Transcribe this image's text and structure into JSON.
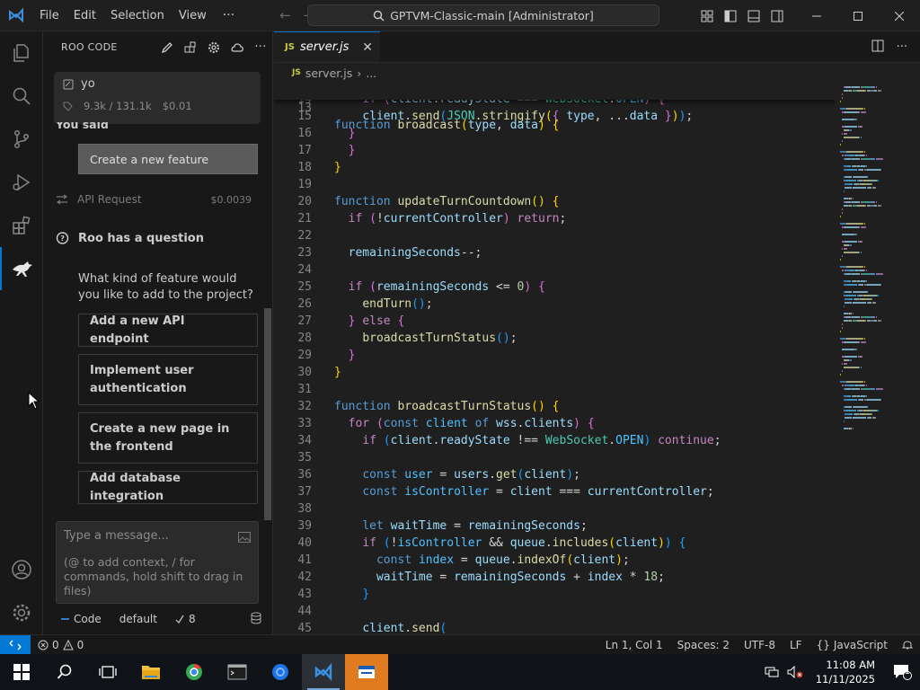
{
  "titlebar": {
    "menu": [
      "File",
      "Edit",
      "Selection",
      "View"
    ],
    "more": "···",
    "command_center": "GPTVM-Classic-main [Administrator]"
  },
  "sidebar": {
    "title": "ROO CODE",
    "task": {
      "title": "yo",
      "tokens": "9.3k / 131.1k",
      "cost": "$0.01"
    },
    "you_said": "You said",
    "user_message": "Create a new feature",
    "api_request": {
      "label": "API Request",
      "cost": "$0.0039"
    },
    "question_title": "Roo has a question",
    "question": "What kind of feature would you like to add to the project?",
    "suggestions": [
      "Add a new API endpoint",
      "Implement user authentication",
      "Create a new page in the frontend",
      "Add database integration"
    ],
    "input": {
      "placeholder": "Type a message...",
      "hint": "(@ to add context, / for commands, hold shift to drag in files)"
    },
    "footer": {
      "mode": "Code",
      "profile": "default",
      "count": "8"
    }
  },
  "editor": {
    "tab": {
      "label": "server.js",
      "icon": "JS"
    },
    "breadcrumb": [
      "server.js",
      "..."
    ],
    "sticky": {
      "num": "13",
      "segs": [
        [
          "k",
          "function "
        ],
        [
          "f",
          "broadcast"
        ],
        [
          "p1",
          "("
        ],
        [
          "v",
          "type"
        ],
        [
          "",
          ","
        ],
        [
          "v",
          " data"
        ],
        [
          "p1",
          ")"
        ],
        [
          "",
          " "
        ],
        [
          "p1",
          "{"
        ]
      ]
    },
    "lines": [
      {
        "num": "14",
        "segs": [
          [
            "",
            "    "
          ],
          [
            "c",
            "if "
          ],
          [
            "p2",
            "("
          ],
          [
            "v",
            "client"
          ],
          [
            "",
            "."
          ],
          [
            "v",
            "readyState"
          ],
          [
            "",
            " === "
          ],
          [
            "t",
            "WebSocket"
          ],
          [
            "",
            "."
          ],
          [
            "con",
            "OPEN"
          ],
          [
            "p2",
            ")"
          ],
          [
            "",
            " "
          ],
          [
            "p2",
            "{"
          ]
        ]
      },
      {
        "num": "15",
        "segs": [
          [
            "",
            "    "
          ],
          [
            "v",
            "client"
          ],
          [
            "",
            "."
          ],
          [
            "f",
            "send"
          ],
          [
            "p3",
            "("
          ],
          [
            "t",
            "JSON"
          ],
          [
            "",
            "."
          ],
          [
            "f",
            "stringify"
          ],
          [
            "p1",
            "("
          ],
          [
            "p2",
            "{"
          ],
          [
            "",
            " "
          ],
          [
            "v",
            "type"
          ],
          [
            "",
            ", ..."
          ],
          [
            "v",
            "data"
          ],
          [
            "",
            " "
          ],
          [
            "p2",
            "}"
          ],
          [
            "p1",
            ")"
          ],
          [
            "p3",
            ")"
          ],
          [
            "",
            ";"
          ]
        ]
      },
      {
        "num": "16",
        "segs": [
          [
            "",
            "  "
          ],
          [
            "p2",
            "}"
          ]
        ]
      },
      {
        "num": "17",
        "segs": [
          [
            "",
            "  "
          ],
          [
            "p2",
            "}"
          ]
        ]
      },
      {
        "num": "18",
        "segs": [
          [
            "p1",
            "}"
          ]
        ]
      },
      {
        "num": "19",
        "segs": [
          [
            "",
            ""
          ]
        ]
      },
      {
        "num": "20",
        "segs": [
          [
            "k",
            "function "
          ],
          [
            "f",
            "updateTurnCountdown"
          ],
          [
            "p1",
            "()"
          ],
          [
            "",
            " "
          ],
          [
            "p1",
            "{"
          ]
        ]
      },
      {
        "num": "21",
        "segs": [
          [
            "",
            "  "
          ],
          [
            "c",
            "if "
          ],
          [
            "p2",
            "("
          ],
          [
            "",
            "!"
          ],
          [
            "v",
            "currentController"
          ],
          [
            "p2",
            ")"
          ],
          [
            "",
            " "
          ],
          [
            "c",
            "return"
          ],
          [
            "",
            ";"
          ]
        ]
      },
      {
        "num": "22",
        "segs": [
          [
            "",
            ""
          ]
        ]
      },
      {
        "num": "23",
        "segs": [
          [
            "",
            "  "
          ],
          [
            "v",
            "remainingSeconds"
          ],
          [
            "",
            "--;"
          ]
        ]
      },
      {
        "num": "24",
        "segs": [
          [
            "",
            ""
          ]
        ]
      },
      {
        "num": "25",
        "segs": [
          [
            "",
            "  "
          ],
          [
            "c",
            "if "
          ],
          [
            "p2",
            "("
          ],
          [
            "v",
            "remainingSeconds"
          ],
          [
            "",
            " <= "
          ],
          [
            "n",
            "0"
          ],
          [
            "p2",
            ")"
          ],
          [
            "",
            " "
          ],
          [
            "p2",
            "{"
          ]
        ]
      },
      {
        "num": "26",
        "segs": [
          [
            "",
            "    "
          ],
          [
            "f",
            "endTurn"
          ],
          [
            "p3",
            "()"
          ],
          [
            "",
            ";"
          ]
        ]
      },
      {
        "num": "27",
        "segs": [
          [
            "",
            "  "
          ],
          [
            "p2",
            "}"
          ],
          [
            "",
            " "
          ],
          [
            "c",
            "else "
          ],
          [
            "p2",
            "{"
          ]
        ]
      },
      {
        "num": "28",
        "segs": [
          [
            "",
            "    "
          ],
          [
            "f",
            "broadcastTurnStatus"
          ],
          [
            "p3",
            "()"
          ],
          [
            "",
            ";"
          ]
        ]
      },
      {
        "num": "29",
        "segs": [
          [
            "",
            "  "
          ],
          [
            "p2",
            "}"
          ]
        ]
      },
      {
        "num": "30",
        "segs": [
          [
            "p1",
            "}"
          ]
        ]
      },
      {
        "num": "31",
        "segs": [
          [
            "",
            ""
          ]
        ]
      },
      {
        "num": "32",
        "segs": [
          [
            "k",
            "function "
          ],
          [
            "f",
            "broadcastTurnStatus"
          ],
          [
            "p1",
            "()"
          ],
          [
            "",
            " "
          ],
          [
            "p1",
            "{"
          ]
        ]
      },
      {
        "num": "33",
        "segs": [
          [
            "",
            "  "
          ],
          [
            "c",
            "for "
          ],
          [
            "p2",
            "("
          ],
          [
            "k",
            "const "
          ],
          [
            "con",
            "client "
          ],
          [
            "k",
            "of "
          ],
          [
            "v",
            "wss"
          ],
          [
            "",
            "."
          ],
          [
            "v",
            "clients"
          ],
          [
            "p2",
            ")"
          ],
          [
            "",
            " "
          ],
          [
            "p2",
            "{"
          ]
        ]
      },
      {
        "num": "34",
        "segs": [
          [
            "",
            "    "
          ],
          [
            "c",
            "if "
          ],
          [
            "p3",
            "("
          ],
          [
            "v",
            "client"
          ],
          [
            "",
            "."
          ],
          [
            "v",
            "readyState"
          ],
          [
            "",
            " !== "
          ],
          [
            "t",
            "WebSocket"
          ],
          [
            "",
            "."
          ],
          [
            "con",
            "OPEN"
          ],
          [
            "p3",
            ")"
          ],
          [
            "",
            " "
          ],
          [
            "c",
            "continue"
          ],
          [
            "",
            ";"
          ]
        ]
      },
      {
        "num": "35",
        "segs": [
          [
            "",
            ""
          ]
        ]
      },
      {
        "num": "36",
        "segs": [
          [
            "",
            "    "
          ],
          [
            "k",
            "const "
          ],
          [
            "con",
            "user"
          ],
          [
            "",
            " = "
          ],
          [
            "v",
            "users"
          ],
          [
            "",
            "."
          ],
          [
            "f",
            "get"
          ],
          [
            "p3",
            "("
          ],
          [
            "v",
            "client"
          ],
          [
            "p3",
            ")"
          ],
          [
            "",
            ";"
          ]
        ]
      },
      {
        "num": "37",
        "segs": [
          [
            "",
            "    "
          ],
          [
            "k",
            "const "
          ],
          [
            "con",
            "isController"
          ],
          [
            "",
            " = "
          ],
          [
            "v",
            "client"
          ],
          [
            "",
            " === "
          ],
          [
            "v",
            "currentController"
          ],
          [
            "",
            ";"
          ]
        ]
      },
      {
        "num": "38",
        "segs": [
          [
            "",
            ""
          ]
        ]
      },
      {
        "num": "39",
        "segs": [
          [
            "",
            "    "
          ],
          [
            "k",
            "let "
          ],
          [
            "v",
            "waitTime"
          ],
          [
            "",
            " = "
          ],
          [
            "v",
            "remainingSeconds"
          ],
          [
            "",
            ";"
          ]
        ]
      },
      {
        "num": "40",
        "segs": [
          [
            "",
            "    "
          ],
          [
            "c",
            "if "
          ],
          [
            "p3",
            "("
          ],
          [
            "",
            "!"
          ],
          [
            "con",
            "isController"
          ],
          [
            "",
            " && "
          ],
          [
            "v",
            "queue"
          ],
          [
            "",
            "."
          ],
          [
            "f",
            "includes"
          ],
          [
            "p1",
            "("
          ],
          [
            "v",
            "client"
          ],
          [
            "p1",
            ")"
          ],
          [
            "p3",
            ")"
          ],
          [
            "",
            " "
          ],
          [
            "p3",
            "{"
          ]
        ]
      },
      {
        "num": "41",
        "segs": [
          [
            "",
            "      "
          ],
          [
            "k",
            "const "
          ],
          [
            "con",
            "index"
          ],
          [
            "",
            " = "
          ],
          [
            "v",
            "queue"
          ],
          [
            "",
            "."
          ],
          [
            "f",
            "indexOf"
          ],
          [
            "p1",
            "("
          ],
          [
            "v",
            "client"
          ],
          [
            "p1",
            ")"
          ],
          [
            "",
            ";"
          ]
        ]
      },
      {
        "num": "42",
        "segs": [
          [
            "",
            "      "
          ],
          [
            "v",
            "waitTime"
          ],
          [
            "",
            " = "
          ],
          [
            "v",
            "remainingSeconds"
          ],
          [
            "",
            " + "
          ],
          [
            "v",
            "index"
          ],
          [
            "",
            " * "
          ],
          [
            "n",
            "18"
          ],
          [
            "",
            ";"
          ]
        ]
      },
      {
        "num": "43",
        "segs": [
          [
            "",
            "    "
          ],
          [
            "p3",
            "}"
          ]
        ]
      },
      {
        "num": "44",
        "segs": [
          [
            "",
            ""
          ]
        ]
      },
      {
        "num": "45",
        "segs": [
          [
            "",
            "    "
          ],
          [
            "v",
            "client"
          ],
          [
            "",
            "."
          ],
          [
            "f",
            "send"
          ],
          [
            "p3",
            "("
          ]
        ]
      }
    ]
  },
  "statusbar": {
    "errors": "0",
    "warnings": "0",
    "position": "Ln 1, Col 1",
    "spaces": "Spaces: 2",
    "encoding": "UTF-8",
    "eol": "LF",
    "language": "JavaScript"
  },
  "taskbar": {
    "time": "11:08 AM",
    "date": "11/11/2025",
    "notifications": "1"
  },
  "colors": {
    "accent": "#0078d4",
    "keyword": "#569cd6",
    "control": "#c586c0",
    "function": "#dcdcaa",
    "variable": "#9cdcfe"
  }
}
